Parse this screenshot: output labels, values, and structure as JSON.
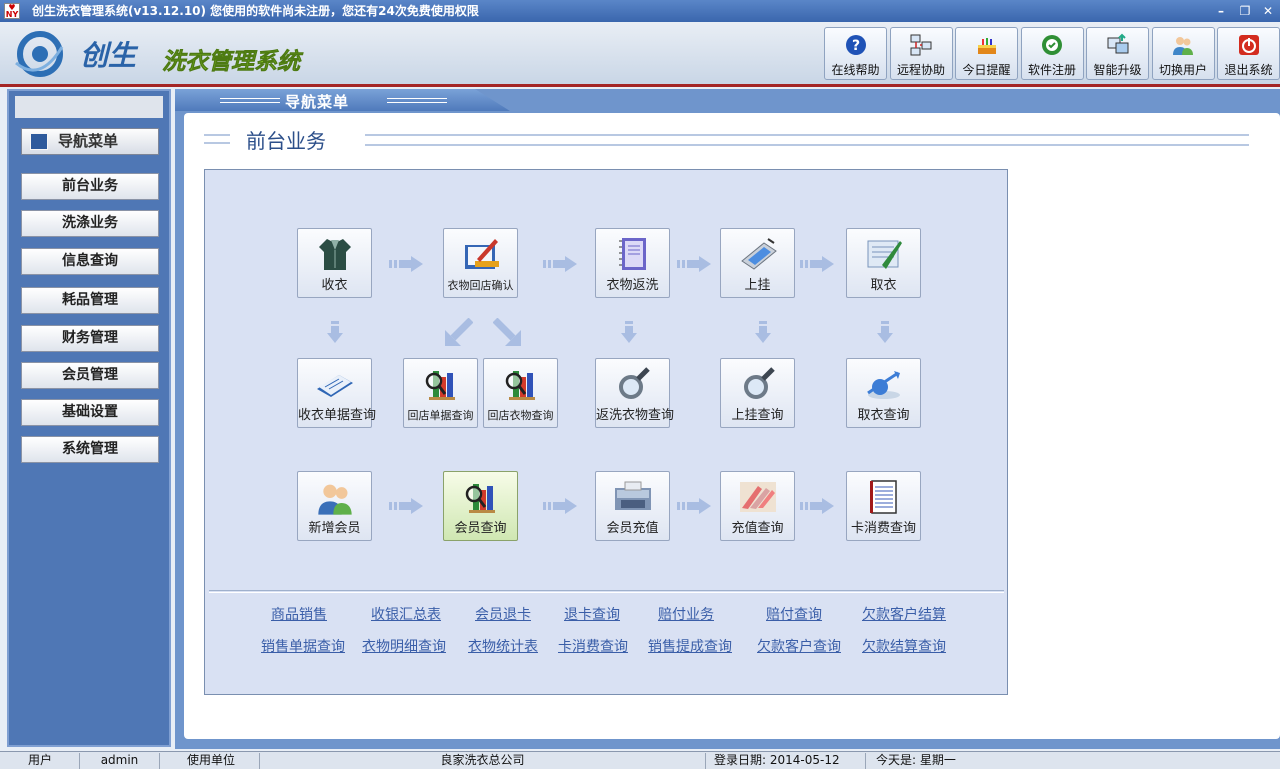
{
  "window": {
    "title": "创生洗衣管理系统(v13.12.10)  您使用的软件尚未注册，您还有24次免费使用权限"
  },
  "logo": {
    "text1": "创生",
    "text2": "洗衣管理系统"
  },
  "toolbar": [
    {
      "id": "help",
      "label": "在线帮助",
      "icon": "help-icon",
      "color": "#1f52b6"
    },
    {
      "id": "remote",
      "label": "远程协助",
      "icon": "network-icon",
      "color": "#3b6bb8"
    },
    {
      "id": "reminder",
      "label": "今日提醒",
      "icon": "cake-icon",
      "color": "#e2871a"
    },
    {
      "id": "register",
      "label": "软件注册",
      "icon": "register-icon",
      "color": "#2f8f35"
    },
    {
      "id": "upgrade",
      "label": "智能升级",
      "icon": "upgrade-icon",
      "color": "#3577c4"
    },
    {
      "id": "switch",
      "label": "切换用户",
      "icon": "users-icon",
      "color": "#3f86c8"
    },
    {
      "id": "exit",
      "label": "退出系统",
      "icon": "power-icon",
      "color": "#d32c1f"
    }
  ],
  "sidebar": {
    "header": "导航菜单",
    "items": [
      "前台业务",
      "洗涤业务",
      "信息查询",
      "耗品管理",
      "财务管理",
      "会员管理",
      "基础设置",
      "系统管理"
    ]
  },
  "main": {
    "tab_title": "导航菜单",
    "section_title": "前台业务",
    "row1": [
      {
        "label": "收衣",
        "icon": "clothes-icon"
      },
      {
        "label": "衣物回店确认",
        "icon": "edit-confirm-icon"
      },
      {
        "label": "衣物返洗",
        "icon": "notebook-icon"
      },
      {
        "label": "上挂",
        "icon": "tablet-icon"
      },
      {
        "label": "取衣",
        "icon": "pickup-icon"
      }
    ],
    "row2": [
      {
        "label": "收衣单据查询",
        "icon": "book-icon"
      },
      {
        "label": "回店单据查询",
        "icon": "chart-search-icon"
      },
      {
        "label": "回店衣物查询",
        "icon": "chart-search-icon"
      },
      {
        "label": "返洗衣物查询",
        "icon": "magnifier-icon"
      },
      {
        "label": "上挂查询",
        "icon": "magnifier-icon"
      },
      {
        "label": "取衣查询",
        "icon": "globe-arrow-icon"
      }
    ],
    "row3": [
      {
        "label": "新增会员",
        "icon": "users-icon"
      },
      {
        "label": "会员查询",
        "icon": "chart-search-icon"
      },
      {
        "label": "会员充值",
        "icon": "money-machine-icon"
      },
      {
        "label": "充值查询",
        "icon": "cash-icon"
      },
      {
        "label": "卡消费查询",
        "icon": "ledger-icon"
      }
    ],
    "links_row1": [
      "商品销售",
      "收银汇总表",
      "会员退卡",
      "退卡查询",
      "赔付业务",
      "赔付查询",
      "欠款客户结算"
    ],
    "links_row2": [
      "销售单据查询",
      "衣物明细查询",
      "衣物统计表",
      "卡消费查询",
      "销售提成查询",
      "欠款客户查询",
      "欠款结算查询"
    ]
  },
  "status": {
    "user_label": "用户",
    "user_value": "admin",
    "unit_label": "使用单位",
    "unit_value": "良家洗衣总公司",
    "login_date": "登录日期: 2014-05-12",
    "today": "今天是: 星期一"
  }
}
